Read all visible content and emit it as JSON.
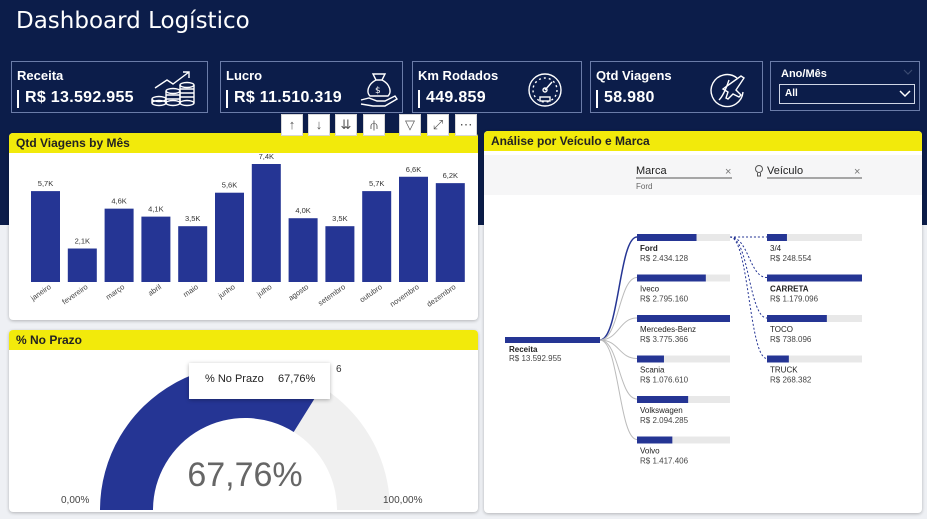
{
  "app": {
    "title": "Dashboard Logístico"
  },
  "kpis": [
    {
      "label": "Receita",
      "value": "R$ 13.592.955",
      "icon": "coin-stack-icon"
    },
    {
      "label": "Lucro",
      "value": "R$ 11.510.319",
      "icon": "money-bag-hand-icon"
    },
    {
      "label": "Km Rodados",
      "value": "449.859",
      "icon": "speedometer-icon"
    },
    {
      "label": "Qtd Viagens",
      "value": "58.980",
      "icon": "airplane-globe-icon"
    }
  ],
  "slicer": {
    "label": "Ano/Mês",
    "selected": "All"
  },
  "toolbar": {
    "buttons": [
      "drill-up-icon",
      "drill-down-icon",
      "expand-next-level-icon",
      "expand-hierarchy-icon",
      "filter-icon",
      "focus-mode-icon",
      "more-options-icon"
    ],
    "glyphs": [
      "↑",
      "↓",
      "⇊",
      "⫛",
      "▽",
      "⤢",
      "⋯"
    ]
  },
  "bar_panel": {
    "title": "Qtd Viagens by Mês"
  },
  "gauge_panel": {
    "title": "% No Prazo",
    "value_label": "67,76%",
    "value": 67.76,
    "min_label": "0,00%",
    "max_label": "100,00%",
    "tooltip_key": "% No Prazo",
    "tooltip_value": "67,76%",
    "clipped_glyph": "6"
  },
  "tree_panel": {
    "title": "Análise por Veículo e Marca",
    "col_marca": "Marca",
    "col_marca_sub": "Ford",
    "col_veiculo": "Veículo",
    "close_glyph": "×",
    "root": {
      "label": "Receita",
      "value": "R$ 13.592.955"
    },
    "brands": [
      {
        "label": "Ford",
        "value": "R$ 2.434.128",
        "fraction": 0.64,
        "bold": true
      },
      {
        "label": "Iveco",
        "value": "R$ 2.795.160",
        "fraction": 0.74
      },
      {
        "label": "Mercedes-Benz",
        "value": "R$ 3.775.366",
        "fraction": 1.0
      },
      {
        "label": "Scania",
        "value": "R$ 1.076.610",
        "fraction": 0.29
      },
      {
        "label": "Volkswagen",
        "value": "R$ 2.094.285",
        "fraction": 0.55
      },
      {
        "label": "Volvo",
        "value": "R$ 1.417.406",
        "fraction": 0.38
      }
    ],
    "vehicles": [
      {
        "label": "3/4",
        "value": "R$ 248.554",
        "fraction": 0.21
      },
      {
        "label": "CARRETA",
        "value": "R$ 1.179.096",
        "fraction": 1.0,
        "bold": true
      },
      {
        "label": "TOCO",
        "value": "R$ 738.096",
        "fraction": 0.63
      },
      {
        "label": "TRUCK",
        "value": "R$ 268.382",
        "fraction": 0.23
      }
    ]
  },
  "colors": {
    "navy": "#0c1d4a",
    "bar": "#253594",
    "yellow": "#f2ea0b",
    "track": "#e8e8e8"
  },
  "chart_data": {
    "type": "bar",
    "title": "Qtd Viagens by Mês",
    "categories": [
      "janeiro",
      "fevereiro",
      "março",
      "abril",
      "maio",
      "junho",
      "julho",
      "agosto",
      "setembro",
      "outubro",
      "novembro",
      "dezembro"
    ],
    "values": [
      5700,
      2100,
      4600,
      4100,
      3500,
      5600,
      7400,
      4000,
      3500,
      5700,
      6600,
      6200
    ],
    "data_labels": [
      "5,7K",
      "2,1K",
      "4,6K",
      "4,1K",
      "3,5K",
      "5,6K",
      "7,4K",
      "4,0K",
      "3,5K",
      "5,7K",
      "6,6K",
      "6,2K"
    ],
    "ylim": [
      0,
      7400
    ],
    "grid": false
  }
}
